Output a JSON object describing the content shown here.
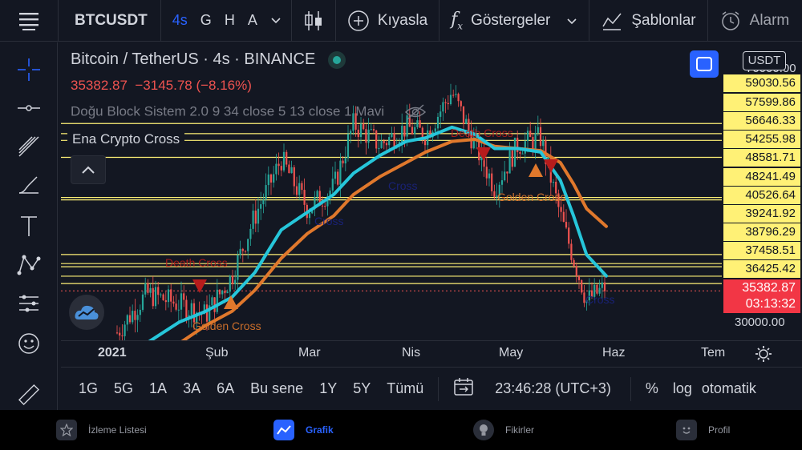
{
  "topbar": {
    "symbol": "BTCUSDT",
    "intervals": [
      "4s",
      "G",
      "H",
      "A"
    ],
    "compare_label": "Kıyasla",
    "indicators_label": "Göstergeler",
    "templates_label": "Şablonlar",
    "alarm_label": "Alarm"
  },
  "legend": {
    "title": "Bitcoin / TetherUS · 4s · BINANCE",
    "price": "35382.87",
    "change": "−3145.78 (−8.16%)",
    "indicator1": "Doğu Block Sistem 2.0 9 34 close 5 13 close 1 Mavi",
    "indicator2": "Ena Crypto Cross"
  },
  "price_axis": {
    "currency": "USDT",
    "top_partial": "70000.00",
    "levels": [
      "59030.56",
      "57599.86",
      "56646.33",
      "54255.98",
      "48581.71",
      "48241.49",
      "40526.64",
      "39241.92",
      "38796.29",
      "37458.51",
      "36425.42"
    ],
    "current_price": "35382.87",
    "countdown": "03:13:32",
    "bottom": "30000.00"
  },
  "time_axis": {
    "labels": [
      "2021",
      "Şub",
      "Mar",
      "Nis",
      "May",
      "Haz",
      "Tem"
    ]
  },
  "annotations": {
    "death_cross": "Death Cross",
    "golden_cross": "Golden Cross",
    "cross": "Cross"
  },
  "range_bar": {
    "ranges": [
      "1G",
      "5G",
      "1A",
      "3A",
      "6A",
      "Bu sene",
      "1Y",
      "5Y",
      "Tümü"
    ],
    "time": "23:46:28 (UTC+3)",
    "percent": "%",
    "log": "log",
    "auto": "otomatik"
  },
  "bottom_nav": {
    "watchlist": "İzleme Listesi",
    "chart": "Grafik",
    "ideas": "Fikirler",
    "profile": "Profil"
  },
  "colors": {
    "accent": "#2962ff",
    "down": "#ef5350",
    "up": "#26a69a",
    "level_line": "#fff176",
    "fast_ma": "#26c6da",
    "slow_ma": "#e0782c"
  },
  "chart_data": {
    "type": "line",
    "x": [
      "2021-01-01",
      "2021-01-10",
      "2021-01-20",
      "2021-01-28",
      "2021-02-05",
      "2021-02-12",
      "2021-02-20",
      "2021-02-28",
      "2021-03-08",
      "2021-03-14",
      "2021-03-22",
      "2021-03-30",
      "2021-04-05",
      "2021-04-13",
      "2021-04-20",
      "2021-04-26",
      "2021-05-03",
      "2021-05-10",
      "2021-05-16",
      "2021-05-20",
      "2021-05-24",
      "2021-05-30"
    ],
    "series": [
      {
        "values": [
          29500,
          35000,
          33500,
          32000,
          37500,
          46000,
          54000,
          47000,
          50000,
          59000,
          56000,
          58500,
          57500,
          63500,
          56000,
          50000,
          56000,
          57000,
          46000,
          40000,
          34000,
          36000
        ]
      },
      {
        "values": [
          24000,
          28000,
          31000,
          32500,
          34500,
          38000,
          44000,
          46500,
          49000,
          52000,
          54500,
          56500,
          57000,
          58500,
          57500,
          55500,
          55500,
          55000,
          51000,
          46000,
          40500,
          37500
        ]
      },
      {
        "values": [
          22000,
          25500,
          28000,
          30500,
          32500,
          35500,
          40000,
          43500,
          46000,
          49000,
          51500,
          53500,
          55000,
          56500,
          56800,
          55800,
          55500,
          55200,
          53500,
          50500,
          47000,
          44500
        ]
      }
    ],
    "ylim": [
      30000,
      70000
    ]
  }
}
